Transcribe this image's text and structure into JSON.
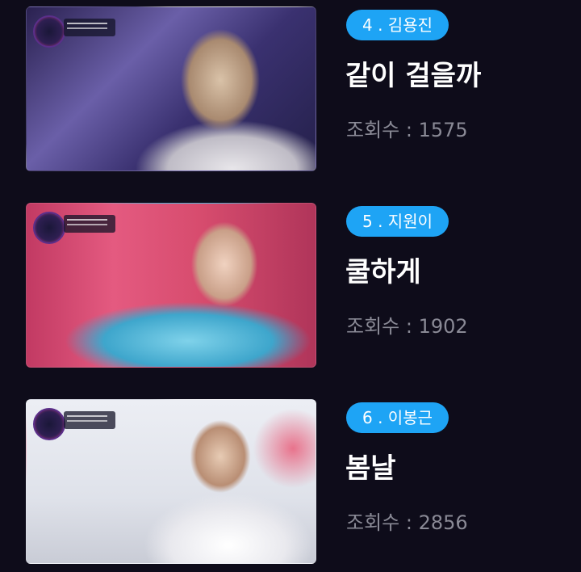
{
  "items": [
    {
      "rank_label": "4 . 김용진",
      "title": "같이 걸을까",
      "views_label": "조회수 : 1575"
    },
    {
      "rank_label": "5 . 지원이",
      "title": "쿨하게",
      "views_label": "조회수 : 1902"
    },
    {
      "rank_label": "6 . 이봉근",
      "title": "봄날",
      "views_label": "조회수 : 2856"
    }
  ],
  "colors": {
    "background": "#0e0c1a",
    "pill": "#1ea4f5",
    "title": "#ffffff",
    "views": "#8a8a96"
  }
}
